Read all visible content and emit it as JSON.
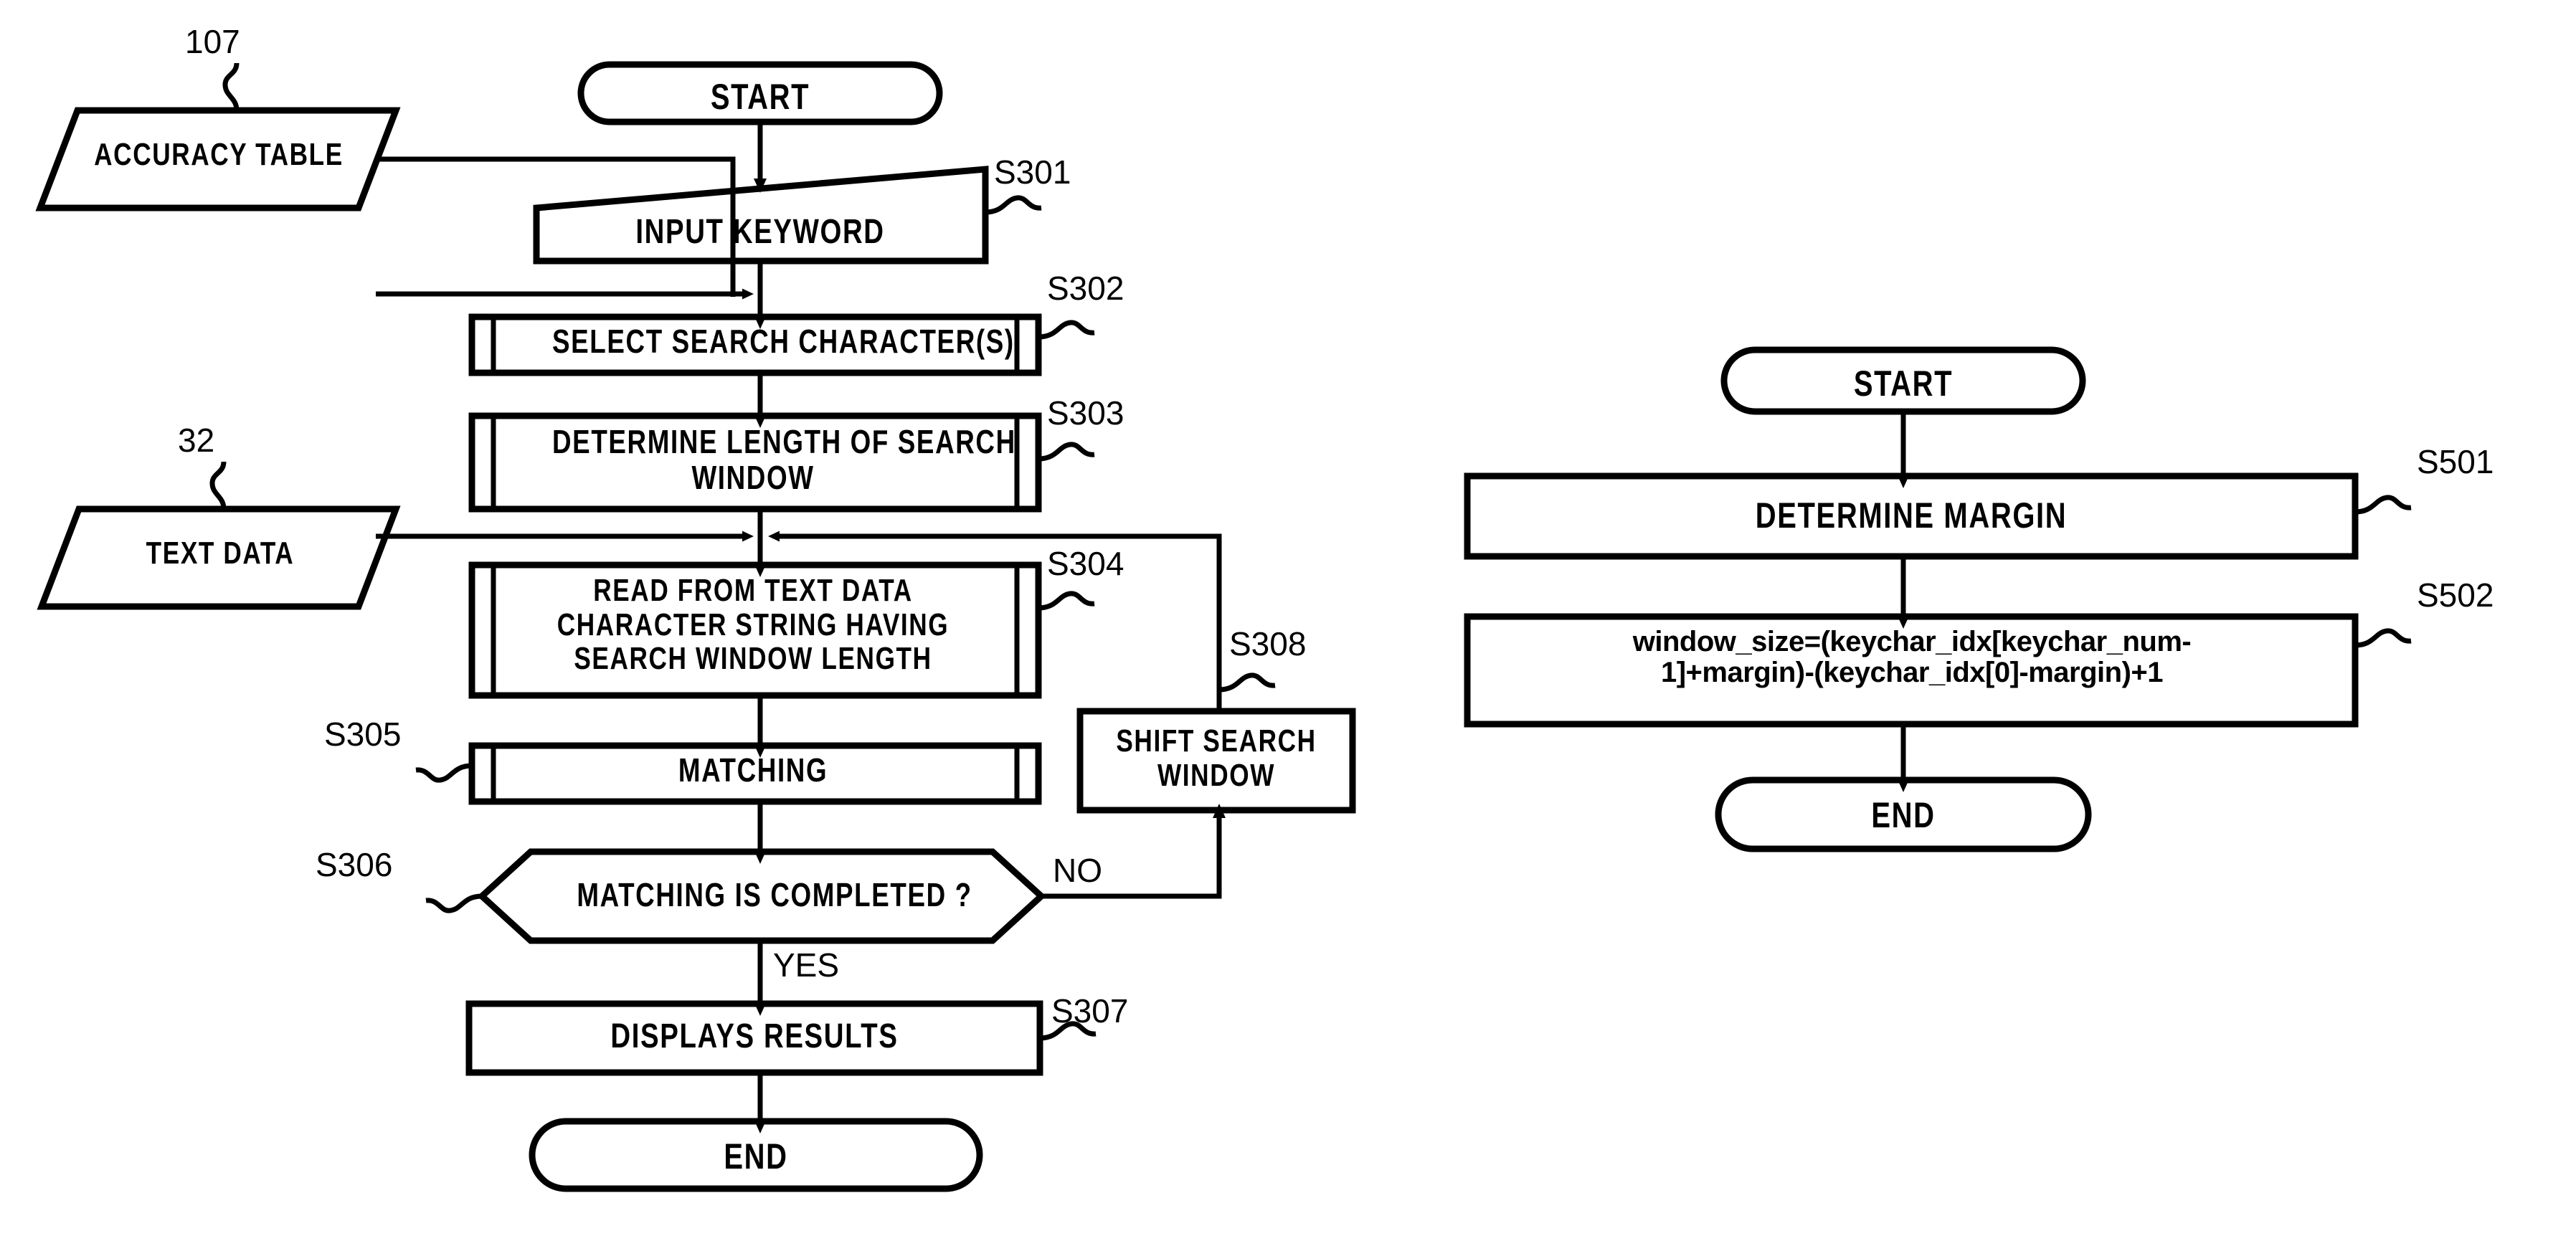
{
  "figure": {
    "type": "patent-flowchart",
    "charts": 2
  },
  "left_flow": {
    "title_nodes": {
      "start": "START",
      "end": "END"
    },
    "nodes": [
      {
        "id": "start",
        "label": "START",
        "shape": "terminator",
        "ref": ""
      },
      {
        "id": "s301",
        "label": "INPUT KEYWORD",
        "shape": "manual-input",
        "ref": "S301"
      },
      {
        "id": "s302",
        "label": "SELECT SEARCH CHARACTER(S)",
        "shape": "predefined-process",
        "ref": "S302"
      },
      {
        "id": "s303",
        "label": "DETERMINE LENGTH OF SEARCH\nWINDOW",
        "shape": "predefined-process",
        "ref": "S303"
      },
      {
        "id": "s304",
        "label": "READ FROM TEXT DATA\nCHARACTER STRING HAVING\nSEARCH WINDOW LENGTH",
        "shape": "predefined-process",
        "ref": "S304"
      },
      {
        "id": "s305",
        "label": "MATCHING",
        "shape": "predefined-process",
        "ref": "S305"
      },
      {
        "id": "s306",
        "label": "MATCHING IS COMPLETED ?",
        "shape": "decision-hexagon",
        "ref": "S306"
      },
      {
        "id": "s307",
        "label": "DISPLAYS RESULTS",
        "shape": "process",
        "ref": "S307"
      },
      {
        "id": "s308",
        "label": "SHIFT SEARCH\nWINDOW",
        "shape": "process",
        "ref": "S308"
      },
      {
        "id": "end",
        "label": "END",
        "shape": "terminator",
        "ref": ""
      }
    ],
    "data_stores": [
      {
        "id": "accuracy_table",
        "label": "ACCURACY TABLE",
        "shape": "parallelogram",
        "ref": "107"
      },
      {
        "id": "text_data",
        "label": "TEXT DATA",
        "shape": "parallelogram",
        "ref": "32"
      }
    ],
    "edge_labels": {
      "no": "NO",
      "yes": "YES"
    }
  },
  "right_flow": {
    "nodes": [
      {
        "id": "start",
        "label": "START",
        "shape": "terminator",
        "ref": ""
      },
      {
        "id": "s501",
        "label": "DETERMINE MARGIN",
        "shape": "process",
        "ref": "S501"
      },
      {
        "id": "s502",
        "label": "window_size=(keychar_idx[keychar_num-\n1]+margin)-(keychar_idx[0]-margin)+1",
        "shape": "process",
        "ref": "S502"
      },
      {
        "id": "end",
        "label": "END",
        "shape": "terminator",
        "ref": ""
      }
    ]
  },
  "colors": {
    "stroke": "#000000",
    "background": "#ffffff",
    "text": "#000000"
  }
}
